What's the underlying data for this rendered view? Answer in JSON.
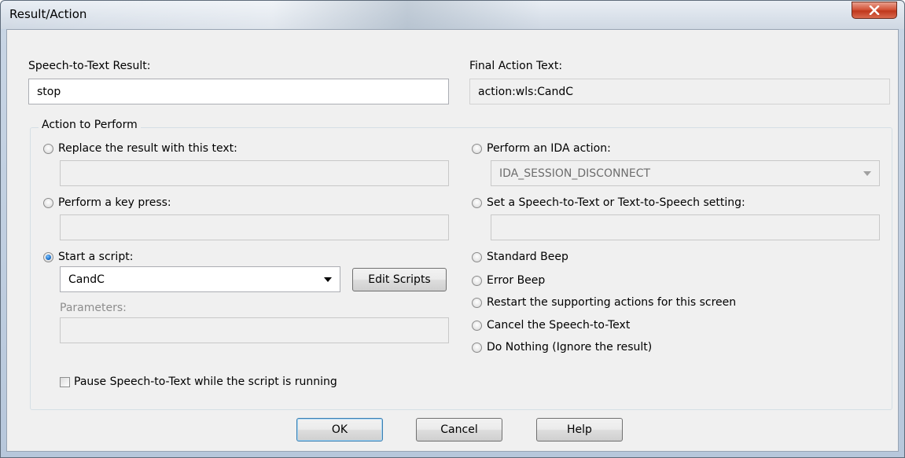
{
  "window": {
    "title": "Result/Action"
  },
  "speech_result": {
    "label": "Speech-to-Text Result:",
    "value": "stop"
  },
  "final_action": {
    "label": "Final Action Text:",
    "value": "action:wls:CandC"
  },
  "group": {
    "caption": "Action to Perform"
  },
  "left_options": {
    "replace_label": "Replace the result with this text:",
    "replace_value": "",
    "keypress_label": "Perform a key press:",
    "keypress_value": "",
    "script_label": "Start a script:",
    "script_selected": "CandC",
    "edit_scripts": "Edit Scripts",
    "parameters_label": "Parameters:",
    "parameters_value": "",
    "pause_label": "Pause Speech-to-Text while the script is running"
  },
  "right_options": {
    "ida_label": "Perform an IDA action:",
    "ida_selected": "IDA_SESSION_DISCONNECT",
    "setting_label": "Set a Speech-to-Text or Text-to-Speech setting:",
    "setting_value": "",
    "standard_beep": "Standard Beep",
    "error_beep": "Error Beep",
    "restart": "Restart the supporting actions for this screen",
    "cancel_stt": "Cancel the Speech-to-Text",
    "do_nothing": "Do Nothing (Ignore the result)"
  },
  "buttons": {
    "ok": "OK",
    "cancel": "Cancel",
    "help": "Help"
  },
  "state": {
    "selected_option": "Start a script:",
    "pause_checked": false
  },
  "colors": {
    "dialog_bg": "#f0f0f0",
    "radio_selected": "#1a6fc9",
    "close_button": "#c0381c"
  }
}
